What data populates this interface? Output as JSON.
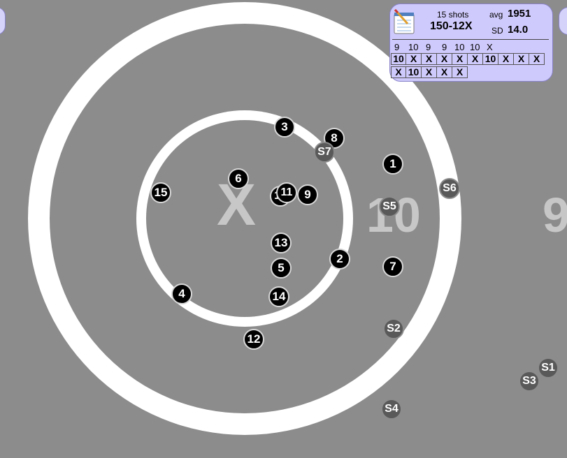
{
  "target": {
    "ring_labels": {
      "x": "X",
      "ten": "10",
      "nine": "9"
    }
  },
  "shots": [
    {
      "label": "1",
      "kind": "record"
    },
    {
      "label": "2",
      "kind": "record"
    },
    {
      "label": "3",
      "kind": "record"
    },
    {
      "label": "4",
      "kind": "record"
    },
    {
      "label": "5",
      "kind": "record"
    },
    {
      "label": "6",
      "kind": "record"
    },
    {
      "label": "7",
      "kind": "record"
    },
    {
      "label": "8",
      "kind": "record"
    },
    {
      "label": "9",
      "kind": "record"
    },
    {
      "label": "10",
      "kind": "record"
    },
    {
      "label": "11",
      "kind": "record"
    },
    {
      "label": "12",
      "kind": "record"
    },
    {
      "label": "13",
      "kind": "record"
    },
    {
      "label": "14",
      "kind": "record"
    },
    {
      "label": "15",
      "kind": "record"
    },
    {
      "label": "S1",
      "kind": "sighter"
    },
    {
      "label": "S2",
      "kind": "sighter"
    },
    {
      "label": "S3",
      "kind": "sighter"
    },
    {
      "label": "S4",
      "kind": "sighter"
    },
    {
      "label": "S5",
      "kind": "sighter"
    },
    {
      "label": "S6",
      "kind": "sighter"
    },
    {
      "label": "S7",
      "kind": "sighter"
    }
  ],
  "score_panel": {
    "icon": "notepad-icon",
    "shots_count": "15 shots",
    "total": "150-12X",
    "avg_label": "avg",
    "avg_value": "1951",
    "sd_label": "SD",
    "sd_value": "14.0",
    "sighter_scores": [
      "9",
      "10",
      "9",
      "9",
      "10",
      "10",
      "X"
    ],
    "scores_row1": [
      "10",
      "X",
      "X",
      "X",
      "X",
      "X",
      "10",
      "X",
      "X",
      "X"
    ],
    "scores_row2": [
      "X",
      "10",
      "X",
      "X",
      "X"
    ]
  }
}
